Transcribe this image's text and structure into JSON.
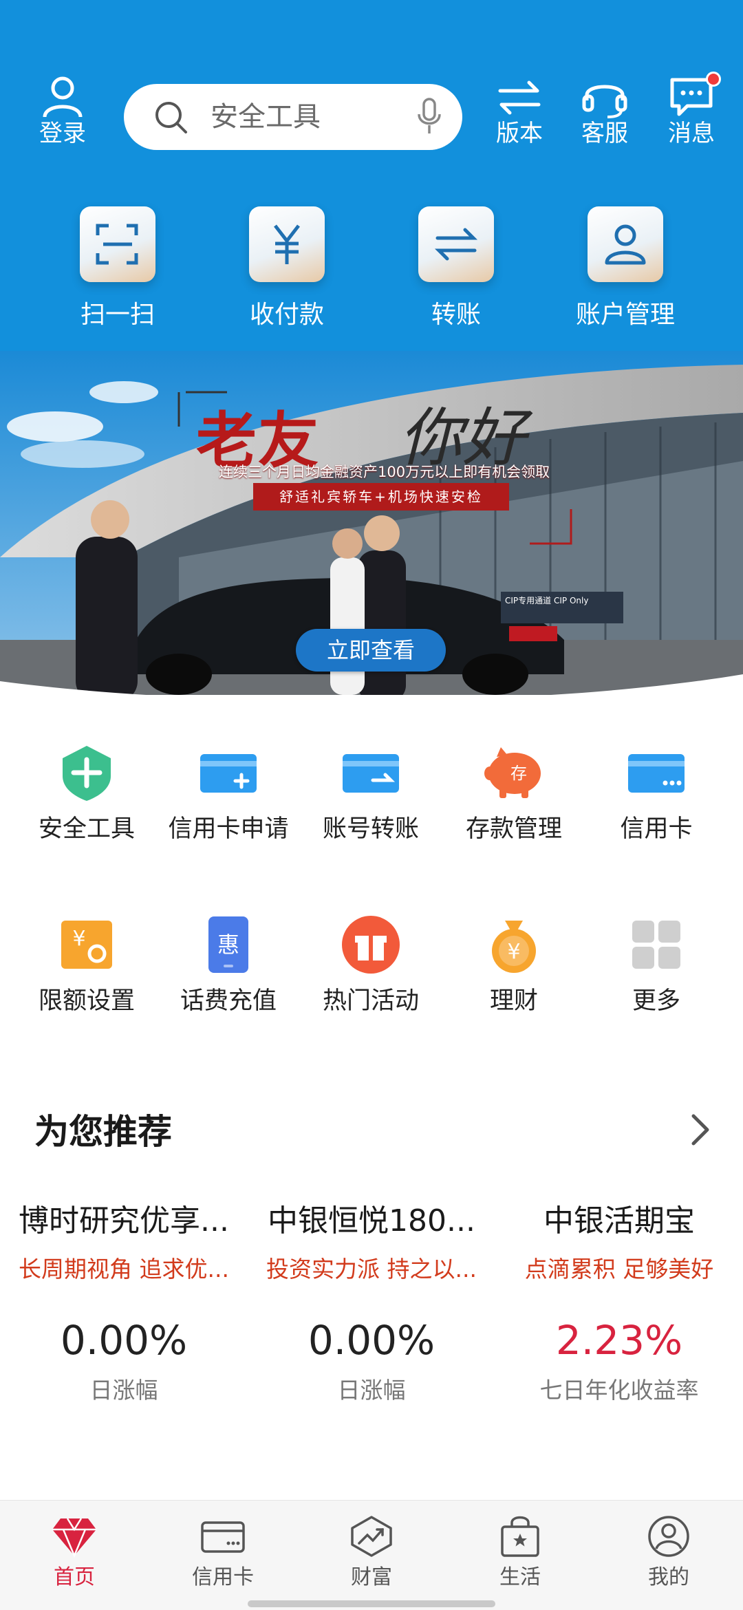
{
  "top": {
    "login_label": "登录",
    "search_placeholder": "安全工具",
    "version_label": "版本",
    "service_label": "客服",
    "messages_label": "消息"
  },
  "quick_actions": [
    {
      "label": "扫一扫",
      "icon": "scan-icon"
    },
    {
      "label": "收付款",
      "icon": "yuan-icon"
    },
    {
      "label": "转账",
      "icon": "transfer-icon"
    },
    {
      "label": "账户管理",
      "icon": "account-icon"
    }
  ],
  "banner": {
    "title_red": "老友",
    "title_black": "你好",
    "subtitle": "连续三个月日均金融资产100万元以上即有机会领取",
    "tag": "舒适礼宾轿车+机场快速安检",
    "cip_sign": "CIP专用通道 CIP Only",
    "cta": "立即查看"
  },
  "services": [
    {
      "label": "安全工具",
      "icon": "shield-plus-icon"
    },
    {
      "label": "信用卡申请",
      "icon": "card-add-icon"
    },
    {
      "label": "账号转账",
      "icon": "card-transfer-icon"
    },
    {
      "label": "存款管理",
      "icon": "piggy-bank-icon"
    },
    {
      "label": "信用卡",
      "icon": "credit-card-icon"
    },
    {
      "label": "限额设置",
      "icon": "limit-settings-icon"
    },
    {
      "label": "话费充值",
      "icon": "phone-topup-icon"
    },
    {
      "label": "热门活动",
      "icon": "gift-icon"
    },
    {
      "label": "理财",
      "icon": "money-bag-icon"
    },
    {
      "label": "更多",
      "icon": "grid-more-icon"
    }
  ],
  "recommend": {
    "heading": "为您推荐",
    "cards": [
      {
        "title": "博时研究优享...",
        "desc": "长周期视角 追求优...",
        "value": "0.00%",
        "unit": "日涨幅",
        "highlight": false
      },
      {
        "title": "中银恒悦180...",
        "desc": "投资实力派 持之以...",
        "value": "0.00%",
        "unit": "日涨幅",
        "highlight": false
      },
      {
        "title": "中银活期宝",
        "desc": "点滴累积 足够美好",
        "value": "2.23%",
        "unit": "七日年化收益率",
        "highlight": true
      }
    ]
  },
  "tabbar": [
    {
      "label": "首页",
      "icon": "diamond-icon",
      "active": true
    },
    {
      "label": "信用卡",
      "icon": "card-icon",
      "active": false
    },
    {
      "label": "财富",
      "icon": "wealth-chart-icon",
      "active": false
    },
    {
      "label": "生活",
      "icon": "shopping-bag-icon",
      "active": false
    },
    {
      "label": "我的",
      "icon": "profile-icon",
      "active": false
    }
  ],
  "colors": {
    "header_blue": "#1290dc",
    "accent_red": "#d8233f",
    "desc_red": "#d23b1c"
  }
}
